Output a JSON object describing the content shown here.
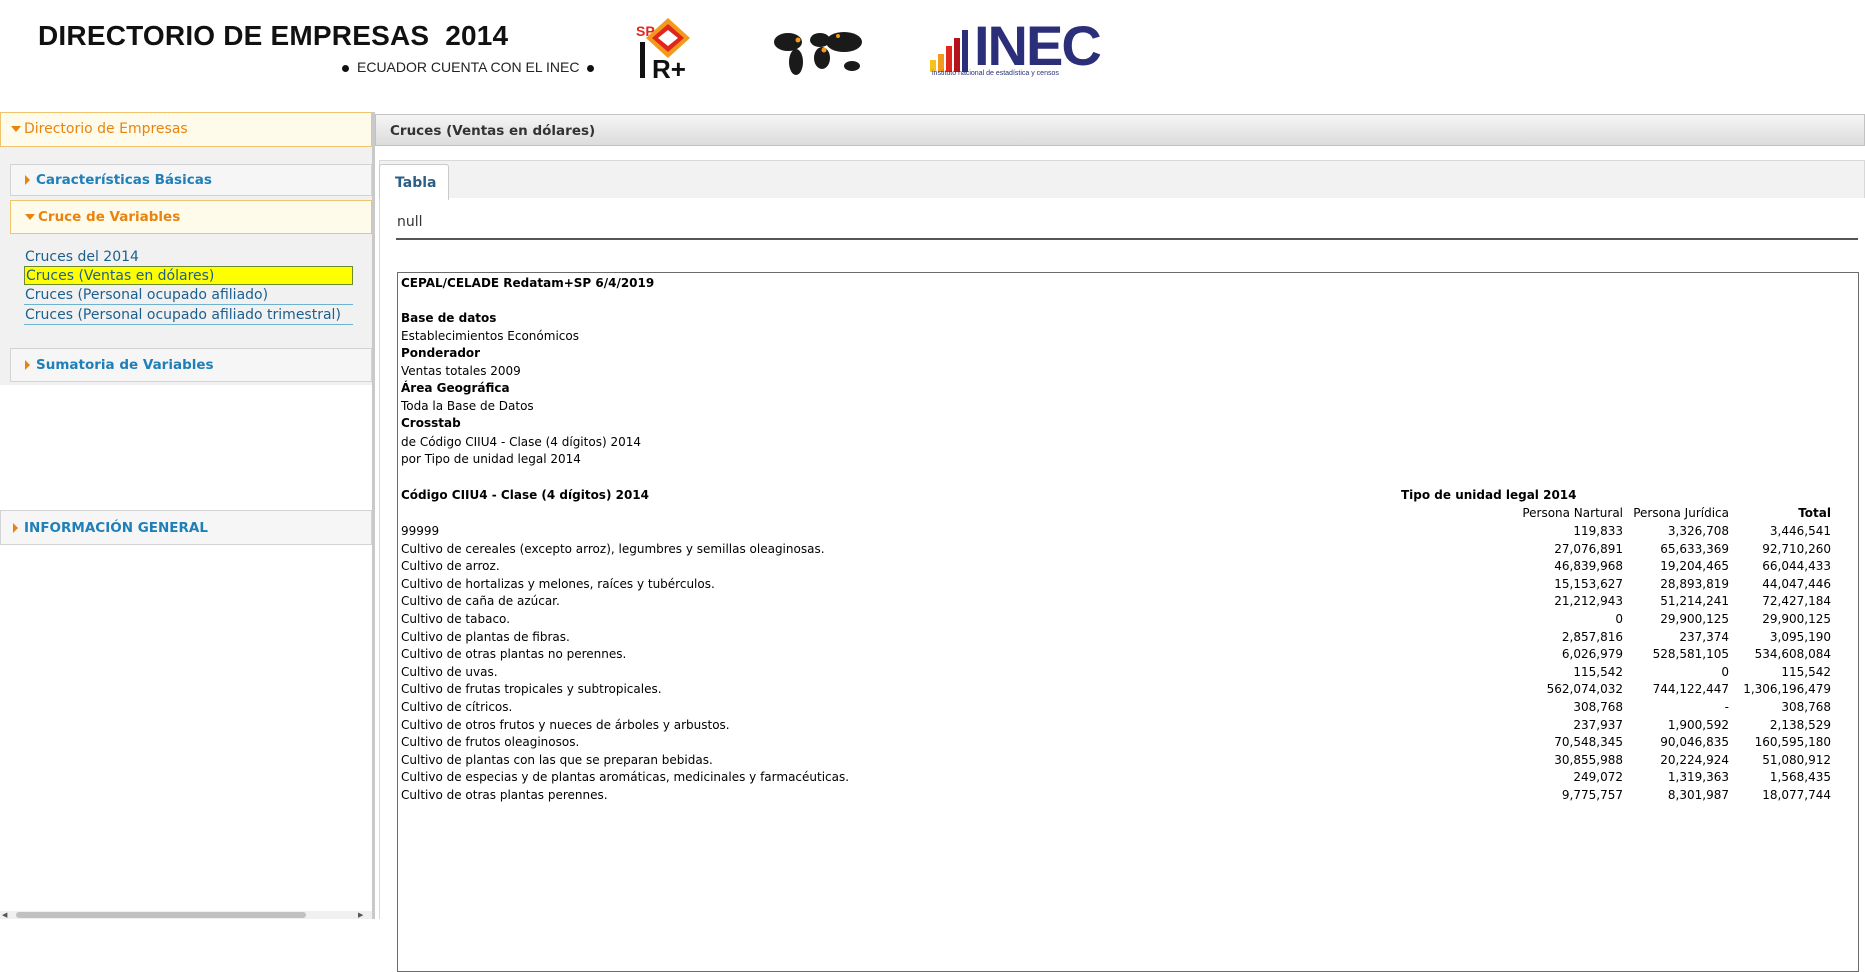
{
  "header": {
    "title": "DIRECTORIO DE EMPRESAS  2014",
    "subtitle": "ECUADOR CUENTA CON EL INEC",
    "logos": {
      "redatam_mark": "SP",
      "redatam_tag": "R+",
      "inec_word": "INEC",
      "inec_tagline": "instituto nacional de estadística y censos"
    }
  },
  "sidebar": {
    "main_section": "Directorio de Empresas",
    "caracteristicas": "Características Básicas",
    "cruce": "Cruce de Variables",
    "cruce_links": [
      "Cruces del 2014",
      "Cruces (Ventas en dólares)",
      "Cruces (Personal ocupado afiliado)",
      "Cruces (Personal ocupado afiliado trimestral)"
    ],
    "sumatoria": "Sumatoria de Variables",
    "informacion": "INFORMACIÓN GENERAL"
  },
  "main": {
    "panel_title": "Cruces (Ventas en dólares)",
    "tab": "Tabla",
    "null_text": "null"
  },
  "report": {
    "source": "CEPAL/CELADE Redatam+SP 6/4/2019",
    "base_label": "Base de datos",
    "base_value": "Establecimientos Económicos",
    "pond_label": "Ponderador",
    "pond_value": "Ventas totales 2009",
    "area_label": "Área Geográfica",
    "area_value": "Toda la Base de Datos",
    "crosstab_label": "Crosstab",
    "crosstab_de": "de Código CIIU4 - Clase (4 dígitos) 2014",
    "crosstab_por": "por Tipo de unidad legal 2014",
    "row_header": "Código CIIU4 - Clase (4 dígitos) 2014",
    "col_group": "Tipo de unidad legal 2014",
    "columns": [
      "Persona Nartural",
      "Persona Jurídica",
      "Total"
    ],
    "rows": [
      {
        "label": "99999",
        "nat": "119,833",
        "jur": "3,326,708",
        "tot": "3,446,541"
      },
      {
        "label": "Cultivo de cereales (excepto arroz), legumbres y semillas oleaginosas.",
        "nat": "27,076,891",
        "jur": "65,633,369",
        "tot": "92,710,260"
      },
      {
        "label": "Cultivo de arroz.",
        "nat": "46,839,968",
        "jur": "19,204,465",
        "tot": "66,044,433"
      },
      {
        "label": "Cultivo de hortalizas y melones, raíces y tubérculos.",
        "nat": "15,153,627",
        "jur": "28,893,819",
        "tot": "44,047,446"
      },
      {
        "label": "Cultivo de caña de azúcar.",
        "nat": "21,212,943",
        "jur": "51,214,241",
        "tot": "72,427,184"
      },
      {
        "label": "Cultivo de tabaco.",
        "nat": "0",
        "jur": "29,900,125",
        "tot": "29,900,125"
      },
      {
        "label": "Cultivo de plantas de fibras.",
        "nat": "2,857,816",
        "jur": "237,374",
        "tot": "3,095,190"
      },
      {
        "label": "Cultivo de otras plantas no perennes.",
        "nat": "6,026,979",
        "jur": "528,581,105",
        "tot": "534,608,084"
      },
      {
        "label": "Cultivo de uvas.",
        "nat": "115,542",
        "jur": "0",
        "tot": "115,542"
      },
      {
        "label": "Cultivo de frutas tropicales y subtropicales.",
        "nat": "562,074,032",
        "jur": "744,122,447",
        "tot": "1,306,196,479"
      },
      {
        "label": "Cultivo de cítricos.",
        "nat": "308,768",
        "jur": "-",
        "tot": "308,768"
      },
      {
        "label": "Cultivo de otros frutos y nueces de árboles y arbustos.",
        "nat": "237,937",
        "jur": "1,900,592",
        "tot": "2,138,529"
      },
      {
        "label": "Cultivo de frutos oleaginosos.",
        "nat": "70,548,345",
        "jur": "90,046,835",
        "tot": "160,595,180"
      },
      {
        "label": "Cultivo de plantas con las que se preparan bebidas.",
        "nat": "30,855,988",
        "jur": "20,224,924",
        "tot": "51,080,912"
      },
      {
        "label": "Cultivo de especias y de plantas aromáticas, medicinales y farmacéuticas.",
        "nat": "249,072",
        "jur": "1,319,363",
        "tot": "1,568,435"
      },
      {
        "label": "Cultivo de otras plantas perennes.",
        "nat": "9,775,757",
        "jur": "8,301,987",
        "tot": "18,077,744"
      }
    ]
  },
  "colors": {
    "accent_orange": "#e8830e",
    "link_blue": "#1f7fb8",
    "highlight": "#ffff00",
    "inec_blue": "#2b2f7a"
  }
}
